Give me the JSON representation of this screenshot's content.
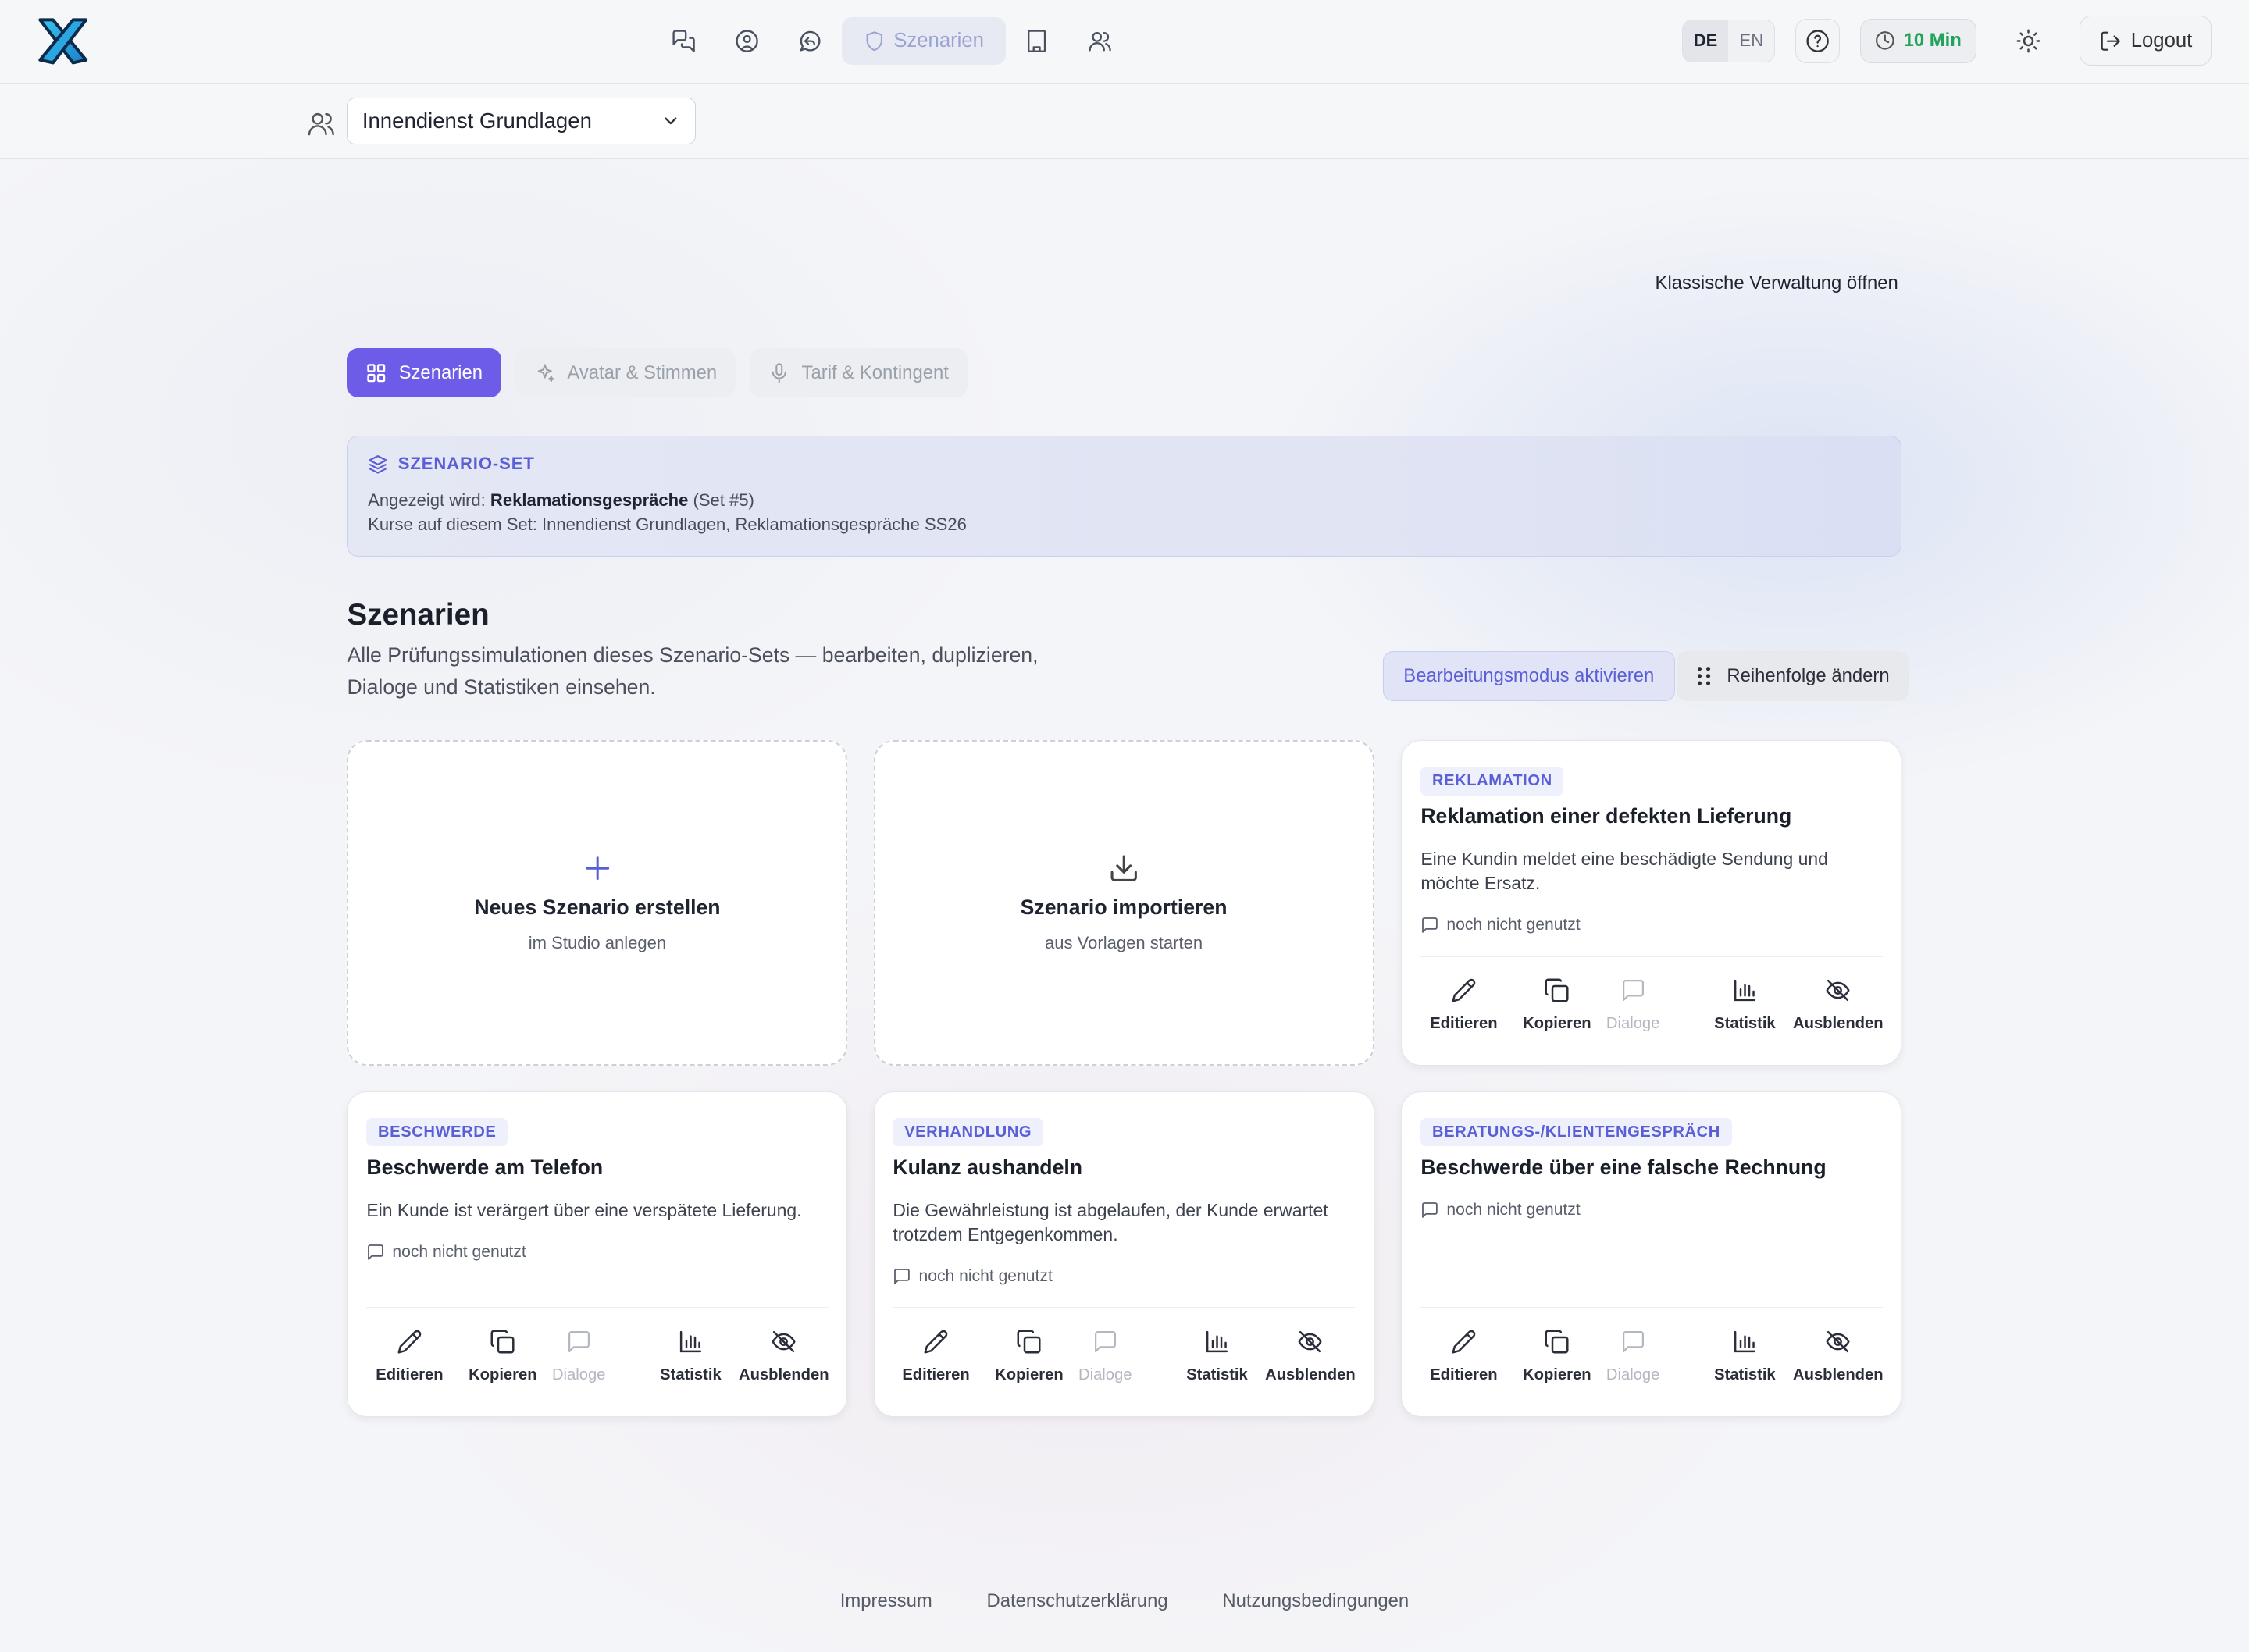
{
  "topbar": {
    "nav": [
      {
        "icon": "chat-bubbles-icon",
        "label": ""
      },
      {
        "icon": "user-circle-icon",
        "label": ""
      },
      {
        "icon": "message-reply-icon",
        "label": ""
      },
      {
        "icon": "shield-icon",
        "label": "Szenarien"
      },
      {
        "icon": "building-icon",
        "label": ""
      },
      {
        "icon": "users-icon",
        "label": ""
      }
    ],
    "lang_de": "DE",
    "lang_en": "EN",
    "timer": "10 Min",
    "logout": "Logout"
  },
  "course": {
    "selected": "Innendienst Grundlagen"
  },
  "classic_link": "Klassische Verwaltung öffnen",
  "tabs": [
    {
      "label": "Szenarien",
      "active": true
    },
    {
      "label": "Avatar & Stimmen",
      "active": false
    },
    {
      "label": "Tarif & Kontingent",
      "active": false
    }
  ],
  "set_panel": {
    "heading": "SZENARIO-SET",
    "shown_prefix": "Angezeigt wird: ",
    "shown_name": "Reklamationsgespräche",
    "shown_suffix": " (Set #5)",
    "courses": "Kurse auf diesem Set: Innendienst Grundlagen, Reklamationsgespräche SS26"
  },
  "section": {
    "title": "Szenarien",
    "description": "Alle Prüfungssimulationen dieses Szenario-Sets — bearbeiten, duplizieren, Dialoge und Statistiken einsehen.",
    "edit_mode": "Bearbeitungsmodus aktivieren",
    "reorder": "Reihenfolge ändern"
  },
  "create_card": {
    "title": "Neues Szenario erstellen",
    "subtitle": "im Studio anlegen"
  },
  "import_card": {
    "title": "Szenario importieren",
    "subtitle": "aus Vorlagen starten"
  },
  "actions": {
    "edit": "Editieren",
    "copy": "Kopieren",
    "dialogs": "Dialoge",
    "stats": "Statistik",
    "hide": "Ausblenden"
  },
  "scenarios": [
    {
      "tag": "REKLAMATION",
      "title": "Reklamation einer defekten Lieferung",
      "description": "Eine Kundin meldet eine beschädigte Sendung und möchte Ersatz.",
      "usage": "noch nicht genutzt"
    },
    {
      "tag": "BESCHWERDE",
      "title": "Beschwerde am Telefon",
      "description": "Ein Kunde ist verärgert über eine verspätete Lieferung.",
      "usage": "noch nicht genutzt"
    },
    {
      "tag": "VERHANDLUNG",
      "title": "Kulanz aushandeln",
      "description": "Die Gewährleistung ist abgelaufen, der Kunde erwartet trotzdem Entgegenkommen.",
      "usage": "noch nicht genutzt"
    },
    {
      "tag": "BERATUNGS-/KLIENTENGESPRÄCH",
      "title": "Beschwerde über eine falsche Rechnung",
      "description": "",
      "usage": "noch nicht genutzt"
    }
  ],
  "footer": [
    "Impressum",
    "Datenschutzerklärung",
    "Nutzungsbedingungen"
  ],
  "colors": {
    "accent": "#6c5ce7",
    "accent_text": "#5b5fd6",
    "timer": "#22a35a"
  }
}
